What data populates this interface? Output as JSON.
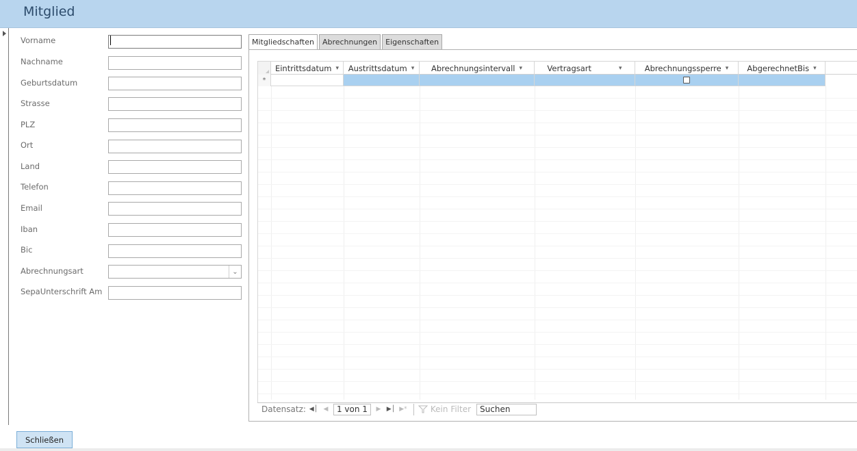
{
  "header": {
    "title": "Mitglied"
  },
  "form": {
    "fields": [
      {
        "label": "Vorname",
        "value": ""
      },
      {
        "label": "Nachname",
        "value": ""
      },
      {
        "label": "Geburtsdatum",
        "value": ""
      },
      {
        "label": "Strasse",
        "value": ""
      },
      {
        "label": "PLZ",
        "value": ""
      },
      {
        "label": "Ort",
        "value": ""
      },
      {
        "label": "Land",
        "value": ""
      },
      {
        "label": "Telefon",
        "value": ""
      },
      {
        "label": "Email",
        "value": ""
      },
      {
        "label": "Iban",
        "value": ""
      },
      {
        "label": "Bic",
        "value": ""
      },
      {
        "label": "Abrechnungsart",
        "value": ""
      },
      {
        "label": "SepaUnterschrift Am",
        "value": ""
      }
    ]
  },
  "tabs": [
    {
      "label": "Mitgliedschaften",
      "active": true
    },
    {
      "label": "Abrechnungen",
      "active": false
    },
    {
      "label": "Eigenschaften",
      "active": false
    }
  ],
  "grid": {
    "columns": [
      "Eintrittsdatum",
      "Austrittsdatum",
      "Abrechnungsintervall",
      "Vertragsart",
      "Abrechnungssperre",
      "AbgerechnetBis"
    ],
    "new_row_marker": "*",
    "sort_arrow": "▾"
  },
  "nav": {
    "label": "Datensatz:",
    "position": "1 von 1",
    "filter": "Kein Filter",
    "search": "Suchen"
  },
  "footer": {
    "close_label": "Schließen"
  },
  "colors": {
    "header": "#b8d5ee",
    "selected_row": "#a9d0f0",
    "button": "#cfe3f4"
  }
}
